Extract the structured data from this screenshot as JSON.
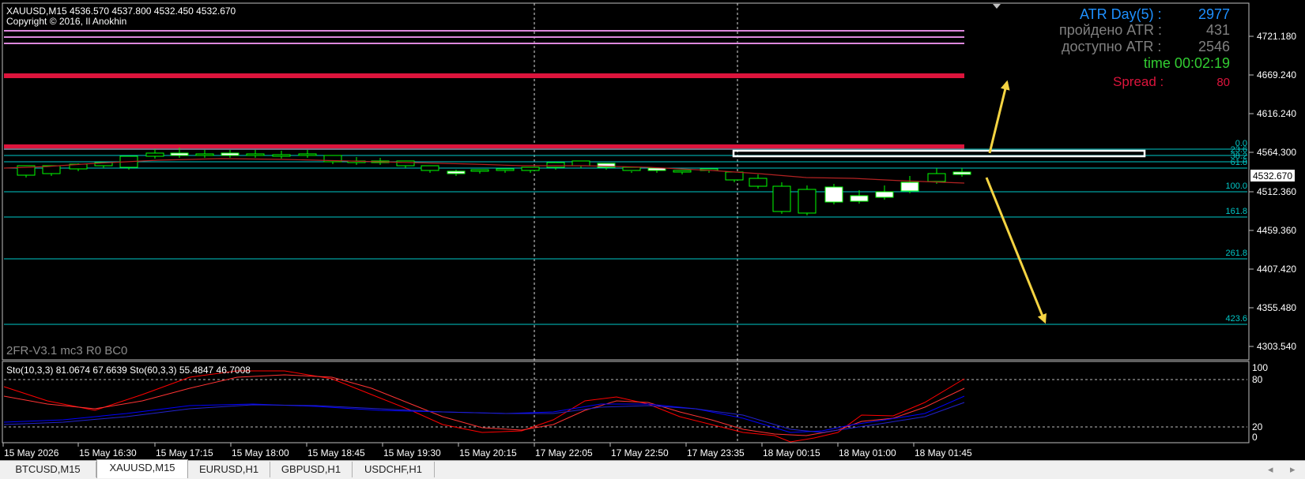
{
  "header": {
    "symbol_line": "XAUUSD,M15  4536.570 4537.800 4532.450 4532.670",
    "copyright": "Copyright © 2016, Il Anokhin"
  },
  "atr_panel": {
    "atr_day_label": "ATR Day(5) :",
    "atr_day_value": "2977",
    "passed_label": "пройдено ATR :",
    "passed_value": "431",
    "available_label": "доступно ATR :",
    "available_value": "2546",
    "time_text": "time 00:02:19",
    "spread_label": "Spread :",
    "spread_value": "80"
  },
  "bottom_label": "2FR-V3.1 mc3 R0 BC0",
  "stochastic": {
    "label": "Sto(10,3,3) 81.0674 67.6639  Sto(60,3,3) 55.4847 46.7008",
    "levels": [
      "100",
      "80",
      "20",
      "0"
    ]
  },
  "price_axis": [
    "4721.180",
    "4669.240",
    "4616.240",
    "4564.300",
    "4512.360",
    "4459.360",
    "4407.420",
    "4355.480",
    "4303.540"
  ],
  "current_price": "4532.670",
  "fib_levels": [
    "0.0",
    "23.6",
    "38.2",
    "61.8",
    "100.0",
    "161.8",
    "261.8",
    "423.6"
  ],
  "time_axis": [
    "15 May 2026",
    "15 May 16:30",
    "15 May 17:15",
    "15 May 18:00",
    "15 May 18:45",
    "15 May 19:30",
    "15 May 20:15",
    "17 May 22:05",
    "17 May 22:50",
    "17 May 23:35",
    "18 May 00:15",
    "18 May 01:00",
    "18 May 01:45"
  ],
  "tabs": [
    {
      "label": "BTCUSD,M15",
      "active": false
    },
    {
      "label": "XAUUSD,M15",
      "active": true
    },
    {
      "label": "EURUSD,H1",
      "active": false
    },
    {
      "label": "GBPUSD,H1",
      "active": false
    },
    {
      "label": "USDCHF,H1",
      "active": false
    }
  ],
  "nav": {
    "left": "◂",
    "right": "▸"
  },
  "colors": {
    "background": "#000000",
    "fib_line": "#00c8c8",
    "resistance": "#dc143c",
    "magenta_lines": "#dd88dd",
    "atr_blue": "#1e90ff",
    "gray_text": "#808080",
    "time_green": "#32cd32",
    "spread_red": "#dc143c",
    "candle_outline": "#00ff00",
    "arrow": "#f5d442",
    "sto_red": "#ff0000",
    "sto_blue": "#0000ff"
  }
}
